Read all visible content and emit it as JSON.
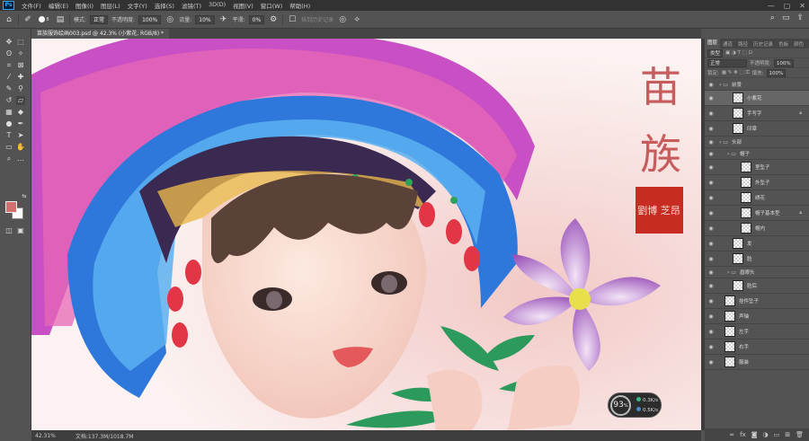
{
  "app": {
    "logo": "Ps"
  },
  "menu": [
    "文件(F)",
    "编辑(E)",
    "图像(I)",
    "图层(L)",
    "文字(Y)",
    "选择(S)",
    "滤镜(T)",
    "3D(D)",
    "视图(V)",
    "窗口(W)",
    "帮助(H)"
  ],
  "window_buttons": [
    "—",
    "▢",
    "✕"
  ],
  "options": {
    "mode_label": "模式:",
    "mode_value": "正常",
    "opacity_label": "不透明度:",
    "opacity_value": "100%",
    "flow_label": "流量:",
    "flow_value": "10%",
    "smooth_label": "平滑:",
    "smooth_value": "0%",
    "erase_history": "抹到历史记录",
    "brush_size": "8"
  },
  "document_tab": "苗族服饰绘画003.psd @ 42.3% (小紫花, RGB/8) *",
  "colors": {
    "foreground": "#d36f6f",
    "background": "#ffffff",
    "accent": "#31a8ff"
  },
  "canvas": {
    "title_line1": "苗",
    "title_line2": "族",
    "seal_text": "劉博 芝昂"
  },
  "status": {
    "zoom": "42.31%",
    "doc_size": "文档:137.3M/1018.7M"
  },
  "hud": {
    "percent": "93",
    "unit": "%",
    "upload": "0.3K/s",
    "download": "0.5K/s"
  },
  "panel": {
    "tabs": [
      "图层",
      "通道",
      "路径",
      "历史记录",
      "色板",
      "颜色"
    ],
    "filter_kind": "类型",
    "blend_mode": "正常",
    "opacity_label": "不透明度:",
    "opacity_value": "100%",
    "lock_label": "锁定:",
    "fill_label": "填充:",
    "fill_value": "100%",
    "layers": [
      {
        "name": "前景",
        "kind": "group",
        "indent": 0,
        "lock": false,
        "selected": false
      },
      {
        "name": "小紫花",
        "kind": "layer",
        "indent": 1,
        "lock": false,
        "selected": true
      },
      {
        "name": "手写字",
        "kind": "layer",
        "indent": 1,
        "lock": true,
        "selected": false
      },
      {
        "name": "印章",
        "kind": "layer",
        "indent": 1,
        "lock": false,
        "selected": false
      },
      {
        "name": "头部",
        "kind": "group",
        "indent": 0,
        "lock": false,
        "selected": false
      },
      {
        "name": "帽子",
        "kind": "group",
        "indent": 1,
        "lock": false,
        "selected": false
      },
      {
        "name": "里坠子",
        "kind": "layer",
        "indent": 2,
        "lock": false,
        "selected": false
      },
      {
        "name": "外坠子",
        "kind": "layer",
        "indent": 2,
        "lock": false,
        "selected": false
      },
      {
        "name": "绣花",
        "kind": "layer",
        "indent": 2,
        "lock": false,
        "selected": false
      },
      {
        "name": "帽子基本型",
        "kind": "layer",
        "indent": 2,
        "lock": true,
        "selected": false
      },
      {
        "name": "帽内",
        "kind": "layer",
        "indent": 2,
        "lock": false,
        "selected": false
      },
      {
        "name": "发",
        "kind": "layer",
        "indent": 1,
        "lock": false,
        "selected": false
      },
      {
        "name": "脸",
        "kind": "layer",
        "indent": 1,
        "lock": false,
        "selected": false
      },
      {
        "name": "眉眼头",
        "kind": "group",
        "indent": 1,
        "lock": false,
        "selected": false
      },
      {
        "name": "脸后",
        "kind": "layer",
        "indent": 1,
        "lock": false,
        "selected": false
      },
      {
        "name": "挂件坠子",
        "kind": "layer",
        "indent": 0,
        "lock": false,
        "selected": false
      },
      {
        "name": "声轴",
        "kind": "layer",
        "indent": 0,
        "lock": false,
        "selected": false
      },
      {
        "name": "左手",
        "kind": "layer",
        "indent": 0,
        "lock": false,
        "selected": false
      },
      {
        "name": "右手",
        "kind": "layer",
        "indent": 0,
        "lock": false,
        "selected": false
      },
      {
        "name": "服装",
        "kind": "layer",
        "indent": 0,
        "lock": false,
        "selected": false
      }
    ],
    "footer_icons": [
      "link-icon",
      "fx-icon",
      "mask-icon",
      "adjustment-icon",
      "folder-icon",
      "new-layer-icon",
      "trash-icon"
    ]
  }
}
